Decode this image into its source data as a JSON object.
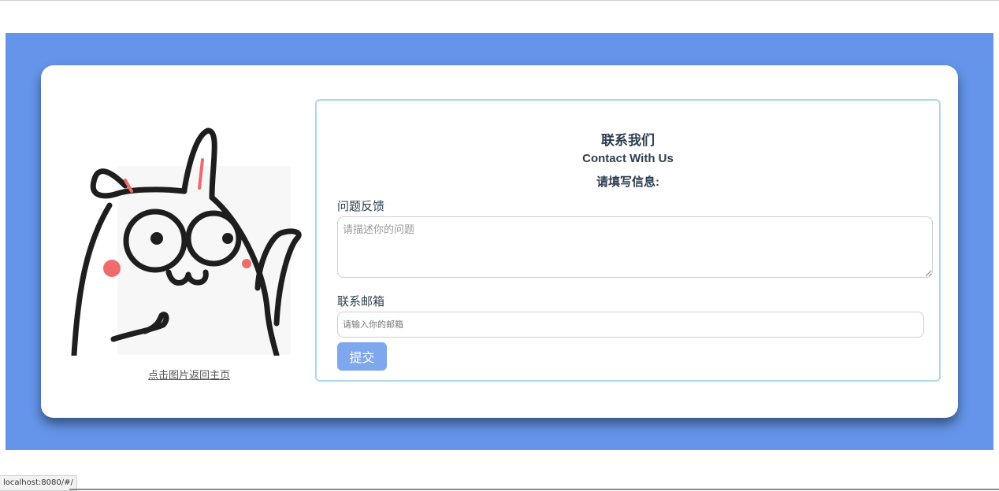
{
  "illustration": {
    "icon": "cartoon-rabbit-shrugging",
    "link_text": "点击图片返回主页"
  },
  "contact_form": {
    "title_cn": "联系我们",
    "title_en": "Contact With Us",
    "instruction": "请填写信息:",
    "feedback_label": "问题反馈",
    "feedback_value": "",
    "feedback_placeholder": "请描述你的问题",
    "email_label": "联系邮箱",
    "email_value": "",
    "email_placeholder": "请输入你的邮箱",
    "submit_label": "提交"
  },
  "status_bar": {
    "url": "localhost:8080/#/"
  },
  "colors": {
    "background_band": "#6495ea",
    "card": "#ffffff",
    "form_border": "#add8e6",
    "submit_button": "#7fa7ee",
    "heading_text": "#2c3e50",
    "cheek_blush": "#f06b6b"
  }
}
